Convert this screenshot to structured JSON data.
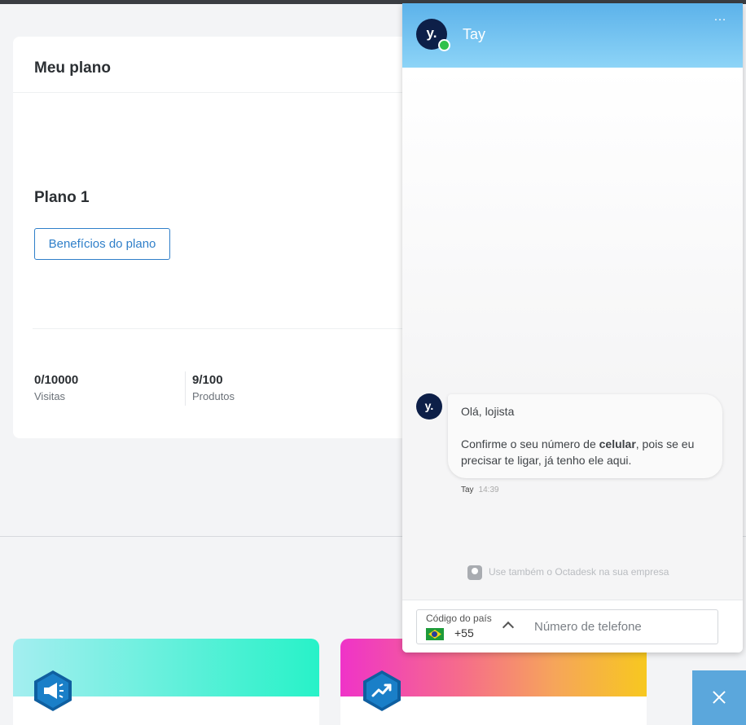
{
  "plan_card": {
    "title": "Meu plano",
    "plan_name": "Plano 1",
    "benefits_button": "Benefícios do plano",
    "stats": [
      {
        "value": "0/10000",
        "label": "Visitas"
      },
      {
        "value": "9/100",
        "label": "Produtos"
      }
    ]
  },
  "chat": {
    "agent_name": "Tay",
    "avatar_text": "y.",
    "menu_icon": "…",
    "message": {
      "greeting": "Olá, lojista",
      "line_before_bold": "Confirme o seu número de ",
      "bold": "celular",
      "line_after_bold": ", pois se eu precisar te ligar, já tenho ele aqui."
    },
    "sender": "Tay",
    "time": "14:39",
    "promo": "Use também o Octadesk na sua empresa",
    "country_label": "Código do país",
    "country_code": "+55",
    "phone_placeholder": "Número de telefone"
  },
  "colors": {
    "accent": "#2f7fc9",
    "chat_header": "#5cb2ea",
    "online": "#30c14c",
    "close_button": "#5ba7dc"
  },
  "icons": [
    "megaphone-icon",
    "trending-up-icon",
    "close-icon",
    "more-options-icon",
    "octadesk-logo-icon",
    "brazil-flag-icon",
    "chevron-up-icon"
  ]
}
